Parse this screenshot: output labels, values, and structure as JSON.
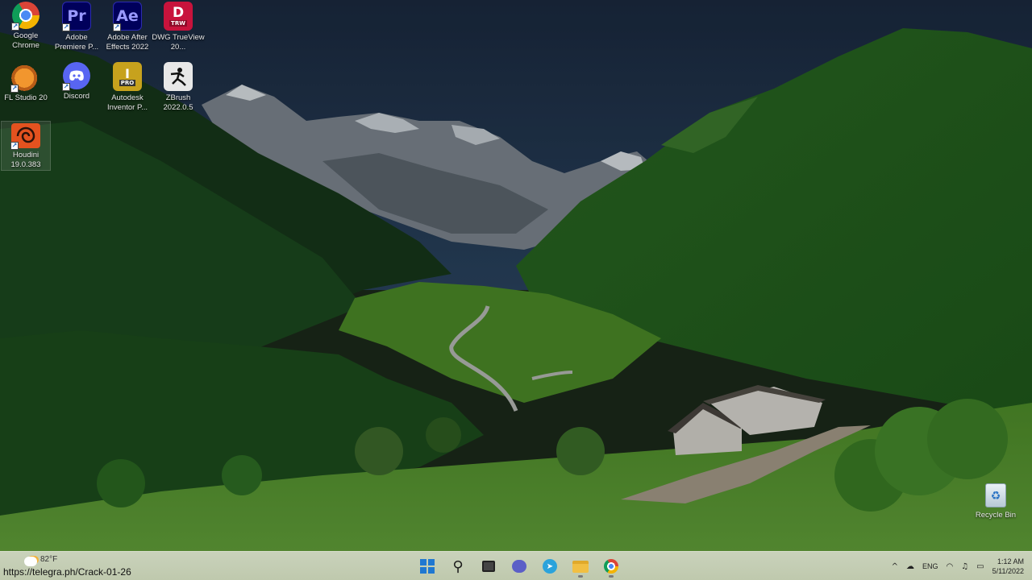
{
  "desktop": {
    "icons": [
      {
        "label": "Google Chrome",
        "icon": "chrome-icon"
      },
      {
        "label": "Adobe Premiere P...",
        "icon": "premiere-icon",
        "glyph": "Pr"
      },
      {
        "label": "Adobe After Effects 2022",
        "icon": "after-effects-icon",
        "glyph": "Ae"
      },
      {
        "label": "DWG TrueView 20...",
        "icon": "dwg-trueview-icon",
        "glyph": "D",
        "sub": "TRW"
      },
      {
        "label": "FL Studio 20",
        "icon": "fl-studio-icon"
      },
      {
        "label": "Discord",
        "icon": "discord-icon"
      },
      {
        "label": "Autodesk Inventor P...",
        "icon": "inventor-icon",
        "glyph": "I",
        "sub": "PRO"
      },
      {
        "label": "ZBrush 2022.0.5",
        "icon": "zbrush-icon"
      },
      {
        "label": "Houdini 19.0.383",
        "icon": "houdini-icon"
      }
    ],
    "recycle_bin": {
      "label": "Recycle Bin",
      "icon": "recycle-bin-icon"
    }
  },
  "taskbar": {
    "weather": {
      "temp": "82°F",
      "icon": "weather-icon"
    },
    "apps": [
      {
        "name": "start",
        "icon": "windows-start-icon"
      },
      {
        "name": "search",
        "icon": "search-icon"
      },
      {
        "name": "task-view",
        "icon": "task-view-icon"
      },
      {
        "name": "teams-chat",
        "icon": "chat-icon"
      },
      {
        "name": "telegram",
        "icon": "telegram-icon"
      },
      {
        "name": "file-explorer",
        "icon": "folder-icon"
      },
      {
        "name": "chrome",
        "icon": "chrome-icon"
      }
    ],
    "tray": {
      "chevron": "^",
      "language": "ENG",
      "time": "1:12 AM",
      "date": "5/11/2022"
    }
  },
  "status_url": "https://telegra.ph/Crack-01-26",
  "colors": {
    "sky": "#1f3048",
    "forest": "#1d4a1e",
    "meadow": "#5d9a33",
    "taskbar": "#c6d0b6",
    "accent": "#1f78d1"
  }
}
